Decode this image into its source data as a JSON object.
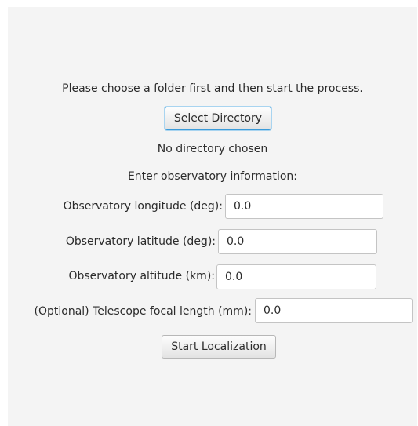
{
  "instructions": "Please choose a folder first and then start the process.",
  "select_directory_label": "Select Directory",
  "directory_status": "No directory chosen",
  "observatory_prompt": "Enter observatory information:",
  "fields": {
    "longitude": {
      "label": "Observatory longitude (deg):",
      "value": "0.0"
    },
    "latitude": {
      "label": "Observatory latitude (deg):",
      "value": "0.0"
    },
    "altitude": {
      "label": "Observatory altitude (km):",
      "value": "0.0"
    },
    "focal_length": {
      "label": "(Optional) Telescope focal length (mm):",
      "value": "0.0"
    }
  },
  "start_label": "Start Localization",
  "colors": {
    "panel_bg": "#f4f4f4",
    "focus_border": "#3a9ad9"
  }
}
